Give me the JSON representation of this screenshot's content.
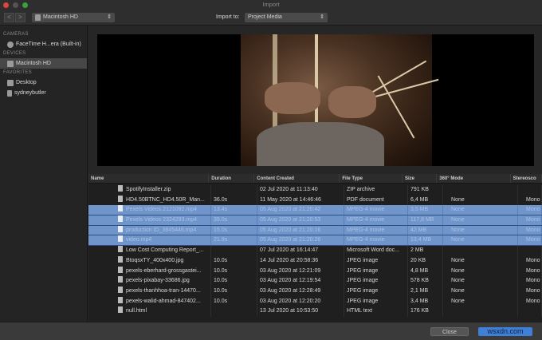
{
  "window": {
    "title": "Import"
  },
  "toolbar": {
    "back": "<",
    "forward": ">",
    "source": "Macintosh HD",
    "import_to_label": "Import to:",
    "import_to_value": "Project Media"
  },
  "sidebar": {
    "sections": [
      {
        "title": "CAMERAS",
        "items": [
          {
            "label": "FaceTime H...era (Built-in)",
            "icon": "camera-icon"
          }
        ]
      },
      {
        "title": "DEVICES",
        "items": [
          {
            "label": "Macintosh HD",
            "icon": "drive-icon",
            "selected": true
          }
        ]
      },
      {
        "title": "FAVORITES",
        "items": [
          {
            "label": "Desktop",
            "icon": "desktop-icon"
          },
          {
            "label": "sydneybutler",
            "icon": "home-icon"
          }
        ]
      }
    ]
  },
  "table": {
    "columns": [
      "Name",
      "Duration",
      "Content Created",
      "File Type",
      "Size",
      "360° Mode",
      "Stereosco"
    ],
    "rows": [
      {
        "name": "SpotifyInstaller.zip",
        "duration": "",
        "created": "02 Jul 2020 at 11:13:40",
        "type": "ZIP archive",
        "size": "791 KB",
        "mode": "",
        "stereo": "",
        "selected": false
      },
      {
        "name": "HD4.50BTNC_HD4.50R_Man...",
        "duration": "36.0s",
        "created": "11 May 2020 at 14:46:46",
        "type": "PDF document",
        "size": "6,4 MB",
        "mode": "None",
        "stereo": "Mono",
        "selected": false
      },
      {
        "name": "Pexels Videos 2121092.mp4",
        "duration": "13.4s",
        "created": "05 Aug 2020 at 21:20:42",
        "type": "MPEG-4 movie",
        "size": "3,5 MB",
        "mode": "None",
        "stereo": "Mono",
        "selected": true
      },
      {
        "name": "Pexels Videos 2324293.mp4",
        "duration": "39.0s",
        "created": "05 Aug 2020 at 21:20:53",
        "type": "MPEG-4 movie",
        "size": "117,8 MB",
        "mode": "None",
        "stereo": "Mono",
        "selected": true
      },
      {
        "name": "production ID_3845446.mp4",
        "duration": "15.0s",
        "created": "05 Aug 2020 at 21:20:16",
        "type": "MPEG-4 movie",
        "size": "42 MB",
        "mode": "None",
        "stereo": "Mono",
        "selected": true
      },
      {
        "name": "video.mp4",
        "duration": "21.9s",
        "created": "05 Aug 2020 at 21:20:26",
        "type": "MPEG-4 movie",
        "size": "13,4 MB",
        "mode": "None",
        "stereo": "Mono",
        "selected": true
      },
      {
        "name": "Low Cost Computing Report_...",
        "duration": "",
        "created": "07 Jul 2020 at 16:14:47",
        "type": "Microsoft Word doc...",
        "size": "2 MB",
        "mode": "",
        "stereo": "",
        "selected": false
      },
      {
        "name": "BtoqsxTY_400x400.jpg",
        "duration": "10.0s",
        "created": "14 Jul 2020 at 20:58:36",
        "type": "JPEG image",
        "size": "20 KB",
        "mode": "None",
        "stereo": "Mono",
        "selected": false
      },
      {
        "name": "pexels-eberhard-grossgastei...",
        "duration": "10.0s",
        "created": "03 Aug 2020 at 12:21:09",
        "type": "JPEG image",
        "size": "4,8 MB",
        "mode": "None",
        "stereo": "Mono",
        "selected": false
      },
      {
        "name": "pexels-pixabay-33686.jpg",
        "duration": "10.0s",
        "created": "03 Aug 2020 at 12:19:54",
        "type": "JPEG image",
        "size": "578 KB",
        "mode": "None",
        "stereo": "Mono",
        "selected": false
      },
      {
        "name": "pexels-thanhhoa-tran-14470...",
        "duration": "10.0s",
        "created": "03 Aug 2020 at 12:28:49",
        "type": "JPEG image",
        "size": "2,1 MB",
        "mode": "None",
        "stereo": "Mono",
        "selected": false
      },
      {
        "name": "pexels-walid-ahmad-847402...",
        "duration": "10.0s",
        "created": "03 Aug 2020 at 12:20:20",
        "type": "JPEG image",
        "size": "3,4 MB",
        "mode": "None",
        "stereo": "Mono",
        "selected": false
      },
      {
        "name": "null.html",
        "duration": "",
        "created": "13 Jul 2020 at 10:53:50",
        "type": "HTML text",
        "size": "176 KB",
        "mode": "",
        "stereo": "",
        "selected": false
      }
    ]
  },
  "footer": {
    "close": "Close",
    "import": "wsxdn.com"
  },
  "colors": {
    "selection": "#6f95cb",
    "accent": "#3f7fd6"
  }
}
